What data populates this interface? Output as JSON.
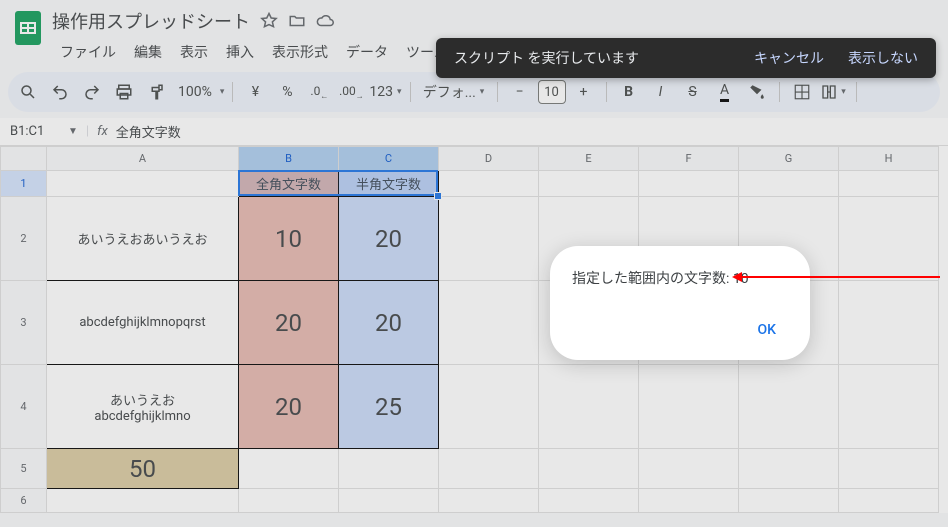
{
  "doc": {
    "title": "操作用スプレッドシート"
  },
  "menu": {
    "file": "ファイル",
    "edit": "編集",
    "view": "表示",
    "insert": "挿入",
    "format": "表示形式",
    "data": "データ",
    "tools": "ツール"
  },
  "toolbar": {
    "zoom": "100%",
    "currency": "¥",
    "percent": "%",
    "dec_dec": ".0",
    "dec_inc": ".00",
    "numfmt": "123",
    "font": "デフォ...",
    "font_size": "10",
    "plus": "+",
    "minus": "−"
  },
  "namebox": {
    "ref": "B1:C1",
    "formula": "全角文字数"
  },
  "cols": {
    "A": "A",
    "B": "B",
    "C": "C",
    "D": "D",
    "E": "E",
    "F": "F",
    "G": "G",
    "H": "H"
  },
  "rows": {
    "r1": "1",
    "r2": "2",
    "r3": "3",
    "r4": "4",
    "r5": "5",
    "r6": "6"
  },
  "cells": {
    "B1": "全角文字数",
    "C1": "半角文字数",
    "A2": "あいうえおあいうえお",
    "B2": "10",
    "C2": "20",
    "A3": "abcdefghijklmnopqrst",
    "B3": "20",
    "C3": "20",
    "A4_l1": "あいうえお",
    "A4_l2": "abcdefghijklmno",
    "B4": "20",
    "C4": "25",
    "A5": "50"
  },
  "toast": {
    "msg": "スクリプト を実行しています",
    "cancel": "キャンセル",
    "dismiss": "表示しない"
  },
  "alert": {
    "text": "指定した範囲内の文字数: 10",
    "ok": "OK"
  }
}
